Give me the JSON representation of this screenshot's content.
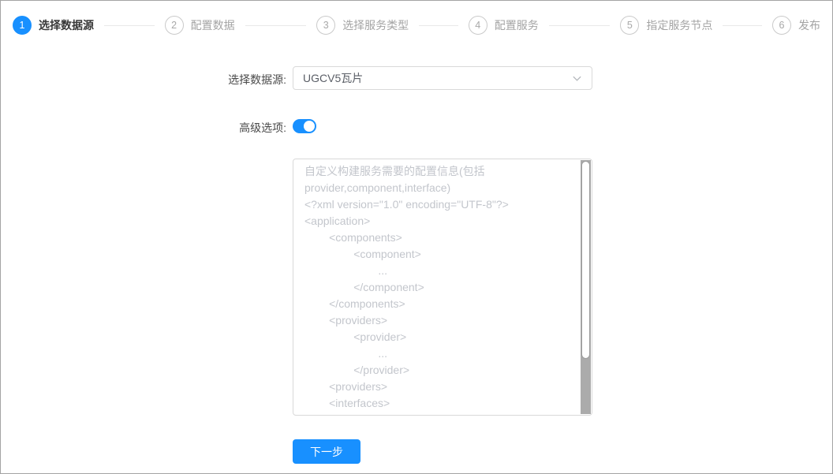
{
  "steps": {
    "items": [
      {
        "number": "1",
        "label": "选择数据源",
        "active": true
      },
      {
        "number": "2",
        "label": "配置数据",
        "active": false
      },
      {
        "number": "3",
        "label": "选择服务类型",
        "active": false
      },
      {
        "number": "4",
        "label": "配置服务",
        "active": false
      },
      {
        "number": "5",
        "label": "指定服务节点",
        "active": false
      },
      {
        "number": "6",
        "label": "发布",
        "active": false
      }
    ]
  },
  "form": {
    "datasource_label": "选择数据源:",
    "datasource_value": "UGCV5瓦片",
    "advanced_label": "高级选项:",
    "advanced_enabled": true,
    "config_placeholder": "自定义构建服务需要的配置信息(包括\nprovider,component,interface)\n<?xml version=\"1.0\" encoding=\"UTF-8\"?>\n<application>\n        <components>\n                <component>\n                        ...\n                </component>\n        </components>\n        <providers>\n                <provider>\n                        ...\n                </provider>\n        <providers>\n        <interfaces>",
    "next_button_label": "下一步"
  },
  "colors": {
    "primary": "#1890ff",
    "inactive_step": "#a4a4a4",
    "border": "#d9d9d9",
    "placeholder": "#c3c6cc"
  }
}
